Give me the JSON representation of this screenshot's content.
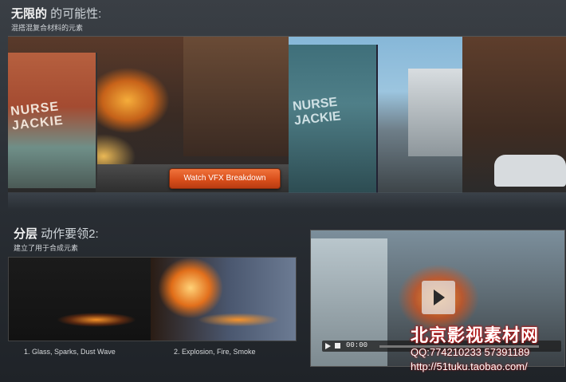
{
  "section1": {
    "title_strong": "无限的",
    "title_light": " 的可能性:",
    "subtitle": "混搭混复合材料的元素",
    "banner": {
      "bus_text": "NURSE JACKIE",
      "bus_text_mid": "NURSE JACKIE",
      "vfx_button_label": "Watch VFX Breakdown"
    }
  },
  "section2": {
    "title_strong": "分层",
    "title_light": " 动作要领2:",
    "subtitle": "建立了用于合成元素",
    "captions": [
      "1. Glass, Sparks, Dust Wave",
      "2. Explosion, Fire, Smoke"
    ]
  },
  "video": {
    "time": "00:00"
  },
  "watermark": {
    "line1": "北京影视素材网",
    "line2": "QQ:774210233  57391189",
    "line3": "http://51tuku.taobao.com/"
  }
}
